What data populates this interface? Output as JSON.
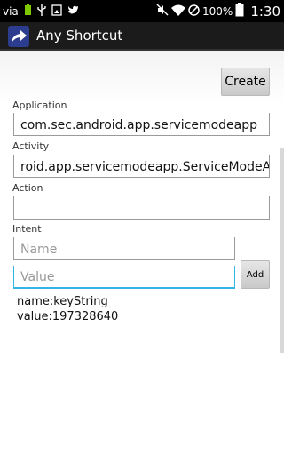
{
  "status_bar": {
    "carrier_label": "via",
    "battery_text": "100%",
    "time": "1:30"
  },
  "action_bar": {
    "title": "Any Shortcut",
    "icon": "share-arrow-icon"
  },
  "form": {
    "create_label": "Create",
    "application_label": "Application",
    "application_value": "com.sec.android.app.servicemodeapp",
    "activity_label": "Activity",
    "activity_value": "roid.app.servicemodeapp.ServiceModeApp",
    "action_label": "Action",
    "action_value": "",
    "intent_label": "Intent",
    "name_placeholder": "Name",
    "value_placeholder": "Value",
    "add_label": "Add",
    "extras": [
      "name:keyString",
      "value:197328640"
    ]
  },
  "colors": {
    "status_bar": "#000000",
    "action_bar": "#1b1b1b",
    "focus_accent": "#33b5e5",
    "app_icon": "#2c3d8f"
  }
}
